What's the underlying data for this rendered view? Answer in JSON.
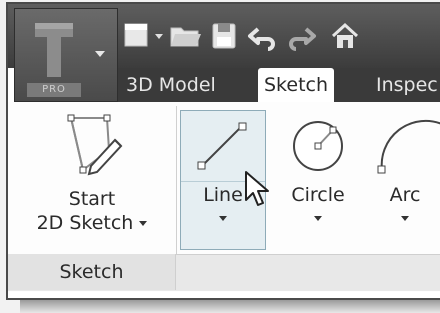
{
  "app": {
    "logo_badge": "PRO",
    "logo_icon": "inventor-logo-icon"
  },
  "quick_access": [
    {
      "name": "new-icon"
    },
    {
      "name": "open-icon"
    },
    {
      "name": "save-icon"
    },
    {
      "name": "undo-icon"
    },
    {
      "name": "redo-icon"
    },
    {
      "name": "home-icon"
    }
  ],
  "tabs": [
    {
      "label": "3D Model",
      "active": false
    },
    {
      "label": "Sketch",
      "active": true
    },
    {
      "label": "Inspec",
      "active": false
    }
  ],
  "ribbon": {
    "start_sketch": {
      "line1": "Start",
      "line2": "2D Sketch",
      "icon": "start-sketch-icon"
    },
    "line": {
      "label": "Line",
      "icon": "line-icon"
    },
    "circle": {
      "label": "Circle",
      "icon": "circle-icon"
    },
    "arc": {
      "label": "Arc",
      "icon": "arc-icon"
    }
  },
  "panel_title": "Sketch",
  "colors": {
    "titlebar": "#4a4a4a",
    "active_tab": "#ffffff",
    "hover_button": "#e5eef2",
    "hover_border": "#8eabb8"
  }
}
